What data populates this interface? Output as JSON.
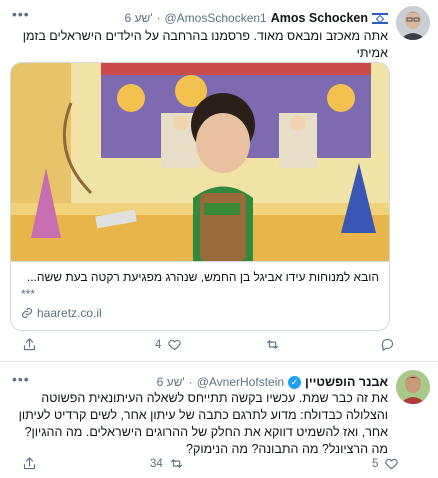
{
  "tweets": [
    {
      "name": "Amos Schocken",
      "handle": "@AmosSchocken1",
      "time": "6 שע'",
      "dot": "·",
      "text": "אתה מאכזב ומבאס מאוד. פרסמנו בהרחבה על הילדים הישראלים בזמן אמיתי",
      "card": {
        "title": "הובא למנוחות עידו אביגל בן החמש, שנהרג מפגיעת רקטה בעת ששה...",
        "more": "***",
        "domain": "haaretz.co.il"
      },
      "likes": "4"
    },
    {
      "name": "אבנר הופשטיין",
      "handle": "@AvnerHofstein",
      "time": "6 שע'",
      "dot": "·",
      "text": "את זה כבר שמת. עכשיו בקשה תתייחס לשאלה העיתונאית הפשוטה והצלולה כבדולח: מדוע לתרגם כתבה של עיתון אחר, לשים קרדיט לעיתון אחר, ואז להשמיט דווקא את החלק של ההרוגים הישראלים. מה ההגיון? מה הרציונל? מה התבונה? מה הנימוק?",
      "retweets": "34",
      "likes": "5"
    }
  ],
  "icons": {
    "menu": "more-icon",
    "reply": "reply-icon",
    "retweet": "retweet-icon",
    "like": "heart-icon",
    "share": "share-icon",
    "link": "link-icon",
    "verified": "verified-icon",
    "flag": "israel-flag-icon"
  },
  "colors": {
    "accent": "#1da1f2",
    "muted": "#5b7083",
    "border": "#e1e8ed"
  }
}
